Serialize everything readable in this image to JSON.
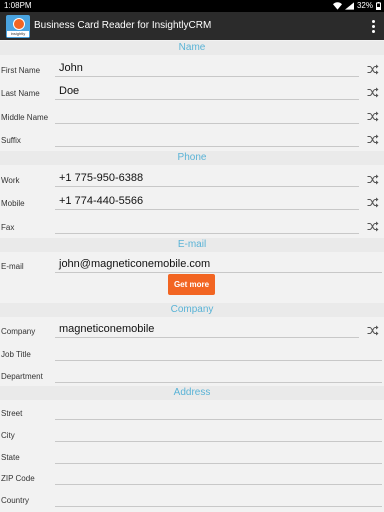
{
  "status_bar": {
    "time": "1:08PM",
    "battery": "32%"
  },
  "app": {
    "title": "Business Card Reader for InsightlyCRM",
    "logo_text": "insightly"
  },
  "sections": {
    "name": "Name",
    "phone": "Phone",
    "email": "E-mail",
    "company": "Company",
    "address": "Address"
  },
  "fields": {
    "first_name": {
      "label": "First Name",
      "value": "John"
    },
    "last_name": {
      "label": "Last Name",
      "value": "Doe"
    },
    "middle_name": {
      "label": "Middle Name",
      "value": ""
    },
    "suffix": {
      "label": "Suffix",
      "value": ""
    },
    "work": {
      "label": "Work",
      "value": "+1 775-950-6388"
    },
    "mobile": {
      "label": "Mobile",
      "value": "+1 774-440-5566"
    },
    "fax": {
      "label": "Fax",
      "value": ""
    },
    "email": {
      "label": "E-mail",
      "value": "john@magneticonemobile.com"
    },
    "company": {
      "label": "Company",
      "value": "magneticonemobile"
    },
    "job_title": {
      "label": "Job Title",
      "value": ""
    },
    "department": {
      "label": "Department",
      "value": ""
    },
    "street": {
      "label": "Street",
      "value": ""
    },
    "city": {
      "label": "City",
      "value": ""
    },
    "state": {
      "label": "State",
      "value": ""
    },
    "zip": {
      "label": "ZIP Code",
      "value": ""
    },
    "country": {
      "label": "Country",
      "value": ""
    }
  },
  "buttons": {
    "get_more": "Get more"
  },
  "colors": {
    "section_text": "#5ab3d6",
    "accent_button": "#f26522",
    "app_bar": "#2b2b2b"
  }
}
